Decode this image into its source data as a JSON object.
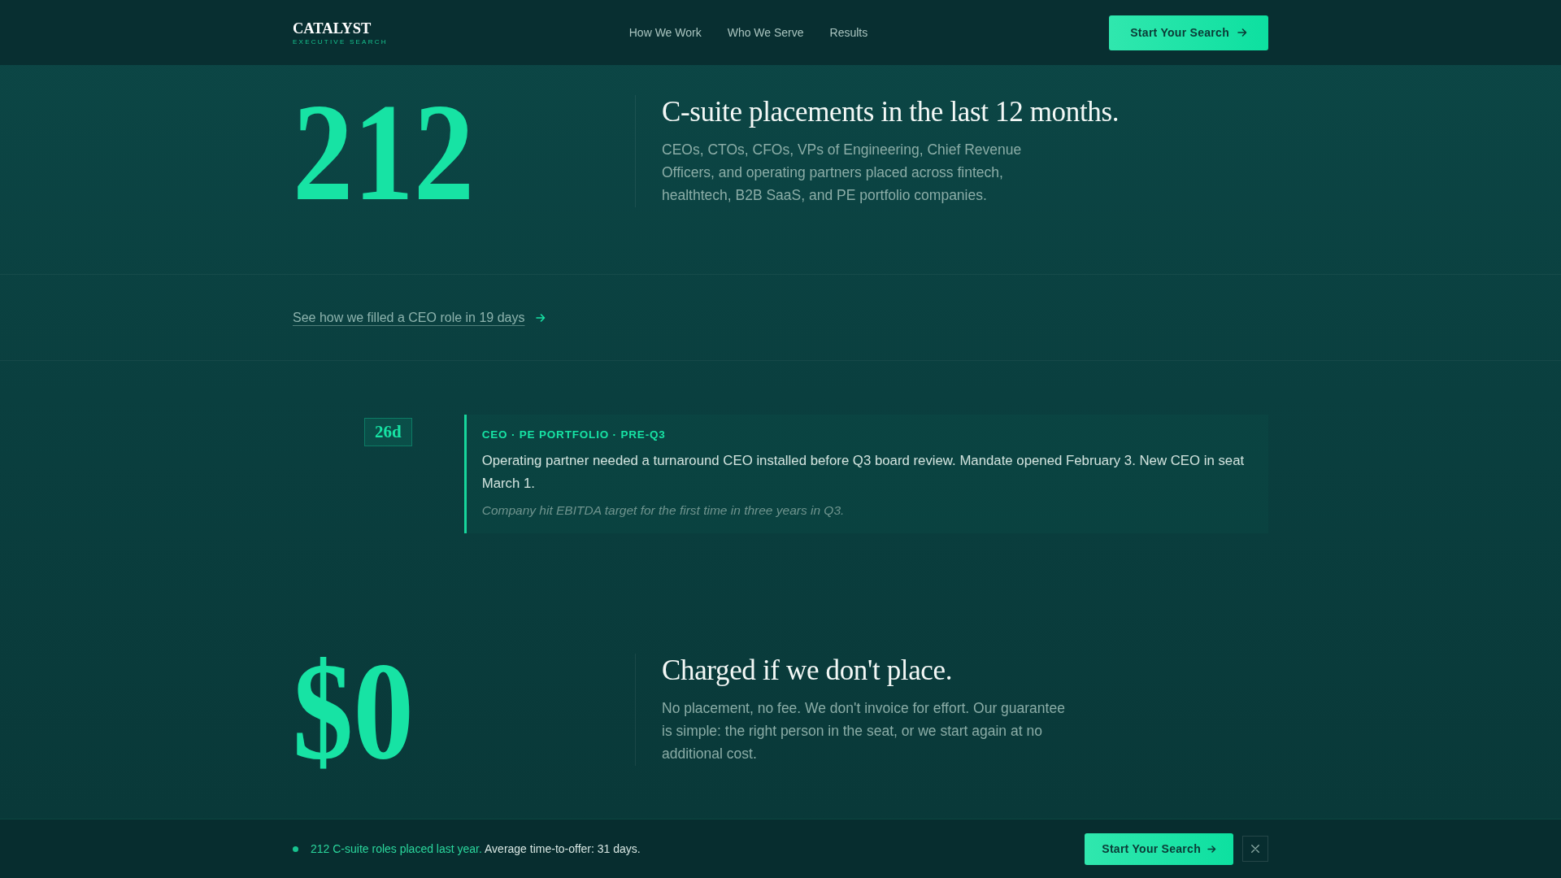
{
  "header": {
    "logo": {
      "name": "CATALYST",
      "tagline": "EXECUTIVE SEARCH"
    },
    "nav": [
      "How We Work",
      "Who We Serve",
      "Results"
    ],
    "cta": "Start Your Search"
  },
  "sections": [
    {
      "kind": "stat",
      "value": "212",
      "heading": "C-suite placements in the last 12 months.",
      "body": "CEOs, CTOs, CFOs, VPs of Engineering, Chief Revenue Officers, and operating partners placed across fintech, healthtech, B2B SaaS, and PE portfolio companies."
    },
    {
      "kind": "link",
      "label": "See how we filled a CEO role in 19 days"
    },
    {
      "kind": "case",
      "badge": "26d",
      "tags": "CEO · PE PORTFOLIO · PRE-Q3",
      "body": "Operating partner needed a turnaround CEO installed before Q3 board review. Mandate opened February 3. New CEO in seat March 1.",
      "outcome": "Company hit EBITDA target for the first time in three years in Q3."
    },
    {
      "kind": "stat",
      "value": "$0",
      "heading": "Charged if we don't place.",
      "body": "No placement, no fee. We don't invoice for effort. Our guarantee is simple: the right person in the seat, or we start again at no additional cost."
    }
  ],
  "sticky_bar": {
    "highlight": "212 C-suite roles placed last year.",
    "text": "Average time-to-offer: 31 days.",
    "cta": "Start Your Search"
  }
}
